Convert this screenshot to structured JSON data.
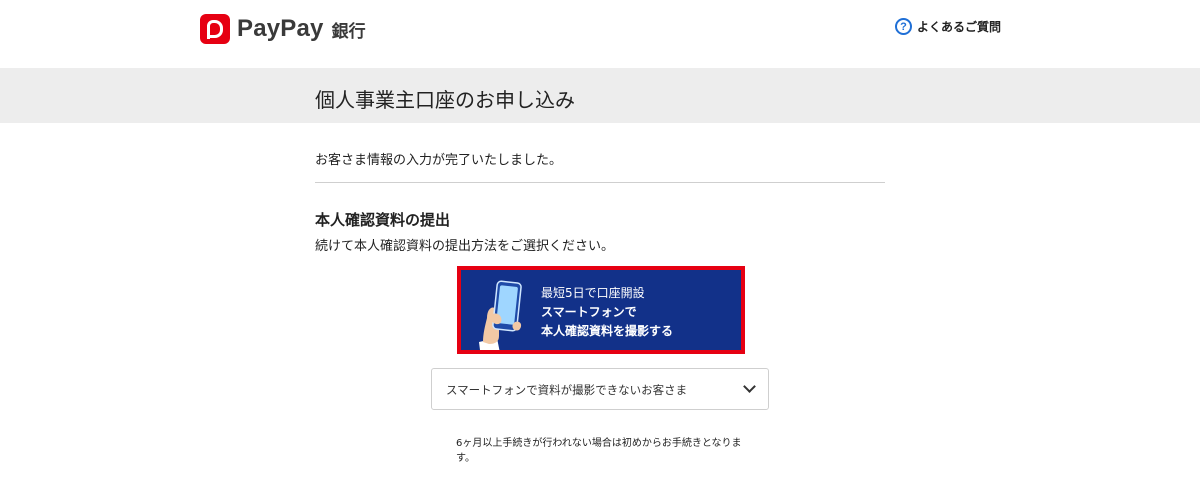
{
  "header": {
    "logo_text": "PayPay",
    "logo_sub": "銀行",
    "faq_icon_glyph": "?",
    "faq_label": "よくあるご質問"
  },
  "page": {
    "title": "個人事業主口座のお申し込み"
  },
  "main": {
    "complete_message": "お客さま情報の入力が完了いたしました。",
    "section_title": "本人確認資料の提出",
    "section_description": "続けて本人確認資料の提出方法をご選択ください。",
    "photo_button": {
      "line1": "最短5日で口座開設",
      "line2": "スマートフォンで",
      "line3": "本人確認資料を撮影する"
    },
    "accordion_label": "スマートフォンで資料が撮影できないお客さま",
    "note": "6ヶ月以上手続きが行われない場合は初めからお手続きとなります。"
  },
  "colors": {
    "brand_red": "#e60012",
    "button_navy": "#123189",
    "band_gray": "#ededed",
    "link_blue": "#1f6fd6"
  }
}
